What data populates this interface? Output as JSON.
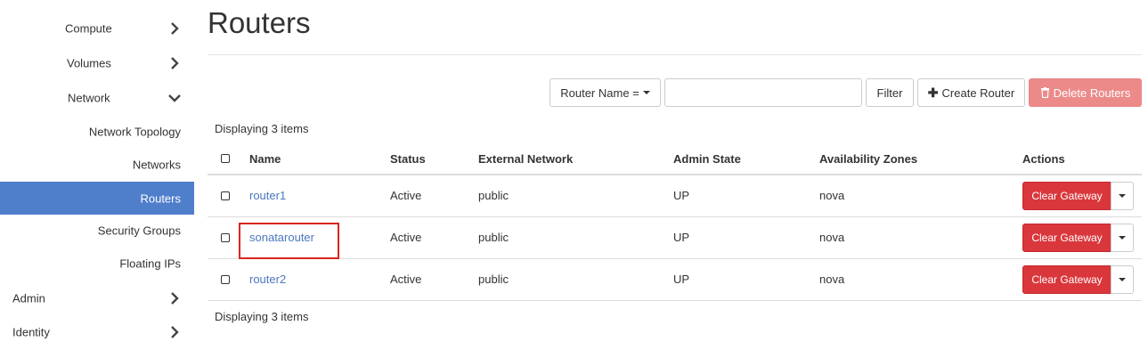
{
  "sidebar": {
    "compute": "Compute",
    "volumes": "Volumes",
    "network": "Network",
    "network_topology": "Network Topology",
    "networks": "Networks",
    "routers": "Routers",
    "security_groups": "Security Groups",
    "floating_ips": "Floating IPs",
    "admin": "Admin",
    "identity": "Identity"
  },
  "page": {
    "title": "Routers"
  },
  "toolbar": {
    "filter_field": "Router Name =",
    "filter_value": "",
    "filter_label": "Filter",
    "create_label": "Create Router",
    "delete_label": "Delete Routers"
  },
  "table": {
    "count_text": "Displaying 3 items",
    "columns": [
      "Name",
      "Status",
      "External Network",
      "Admin State",
      "Availability Zones",
      "Actions"
    ],
    "rows": [
      {
        "name": "router1",
        "status": "Active",
        "external_network": "public",
        "admin_state": "UP",
        "zones": "nova",
        "action": "Clear Gateway"
      },
      {
        "name": "sonatarouter",
        "status": "Active",
        "external_network": "public",
        "admin_state": "UP",
        "zones": "nova",
        "action": "Clear Gateway"
      },
      {
        "name": "router2",
        "status": "Active",
        "external_network": "public",
        "admin_state": "UP",
        "zones": "nova",
        "action": "Clear Gateway"
      }
    ]
  },
  "colors": {
    "accent": "#4f7ecb",
    "danger": "#d9373c",
    "danger_light": "#ec8a8a",
    "link": "#4a77c0",
    "highlight": "#d9261c"
  },
  "icons": [
    "chevron-right-icon",
    "chevron-down-icon",
    "caret-down-icon",
    "plus-icon",
    "trash-icon"
  ]
}
